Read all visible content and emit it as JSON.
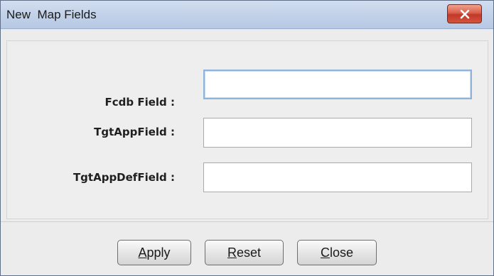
{
  "window": {
    "title": "New  Map Fields"
  },
  "titlebar": {
    "close_icon": "close-icon",
    "close_color": "#c0392b"
  },
  "form": {
    "fields": [
      {
        "label": "Fcdb Field :",
        "value": "",
        "focused": true
      },
      {
        "label": "TgtAppField :",
        "value": "",
        "focused": false
      },
      {
        "label": "TgtAppDefField :",
        "value": "",
        "focused": false
      }
    ]
  },
  "buttons": {
    "apply": {
      "mnemonic": "A",
      "rest": "pply"
    },
    "reset": {
      "mnemonic": "R",
      "rest": "eset"
    },
    "close": {
      "mnemonic": "C",
      "rest": "lose"
    }
  }
}
